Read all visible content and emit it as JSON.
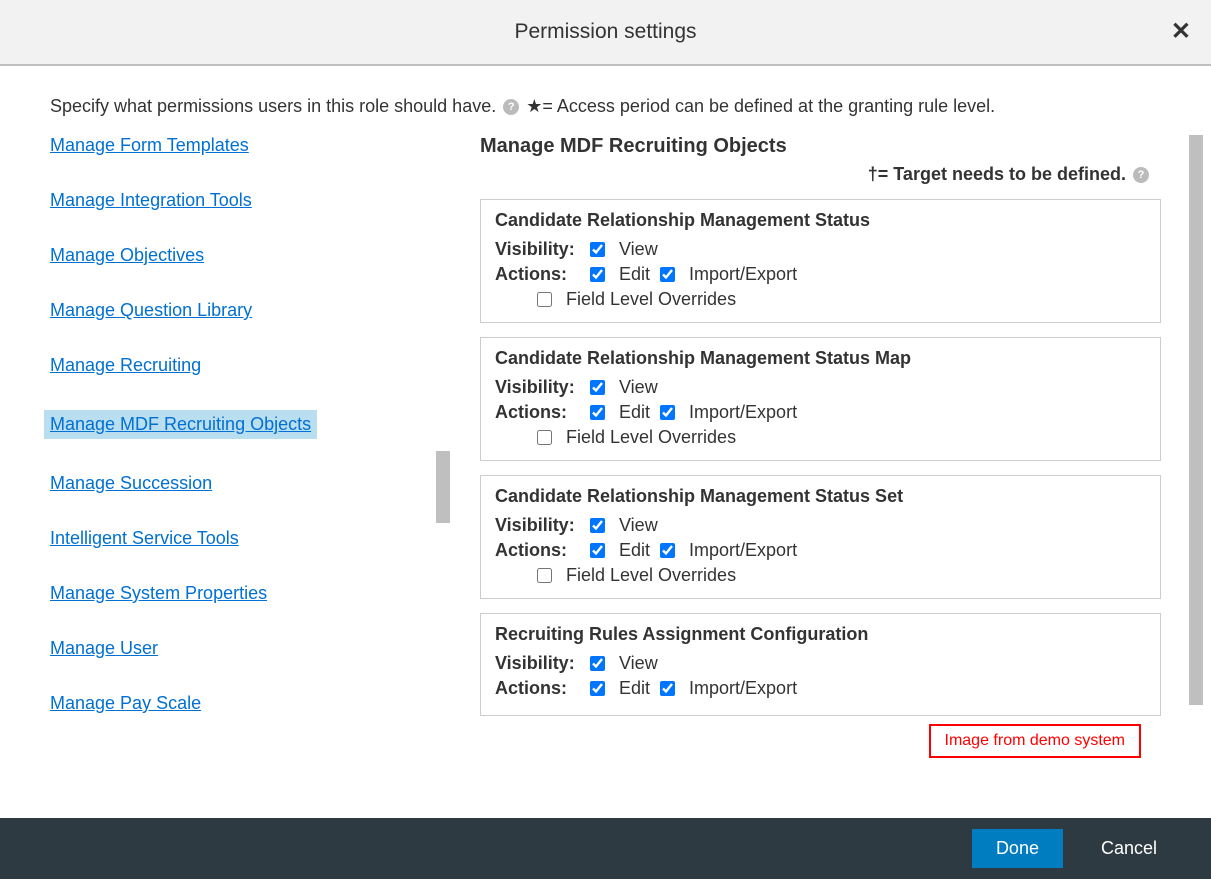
{
  "header": {
    "title": "Permission settings"
  },
  "intro": {
    "text_before_icon": "Specify what permissions users in this role should have.",
    "text_after_icon": "★= Access period can be defined at the granting rule level."
  },
  "sidebar": {
    "items": [
      {
        "label": "Manage Form Templates",
        "selected": false
      },
      {
        "label": "Manage Integration Tools",
        "selected": false
      },
      {
        "label": "Manage Objectives",
        "selected": false
      },
      {
        "label": "Manage Question Library",
        "selected": false
      },
      {
        "label": "Manage Recruiting",
        "selected": false
      },
      {
        "label": "Manage MDF Recruiting Objects",
        "selected": true
      },
      {
        "label": "Manage Succession",
        "selected": false
      },
      {
        "label": "Intelligent Service Tools",
        "selected": false
      },
      {
        "label": "Manage System Properties",
        "selected": false
      },
      {
        "label": "Manage User",
        "selected": false
      },
      {
        "label": "Manage Pay Scale",
        "selected": false
      }
    ]
  },
  "main": {
    "heading": "Manage MDF Recruiting Objects",
    "sub_heading": "†= Target needs to be defined.",
    "labels": {
      "visibility": "Visibility:",
      "actions": "Actions:",
      "view": "View",
      "edit": "Edit",
      "import_export": "Import/Export",
      "flo": "Field Level Overrides"
    },
    "groups": [
      {
        "title": "Candidate Relationship Management Status",
        "view": true,
        "edit": true,
        "import_export": true,
        "flo": false
      },
      {
        "title": "Candidate Relationship Management Status Map",
        "view": true,
        "edit": true,
        "import_export": true,
        "flo": false
      },
      {
        "title": "Candidate Relationship Management Status Set",
        "view": true,
        "edit": true,
        "import_export": true,
        "flo": false
      },
      {
        "title": "Recruiting Rules Assignment Configuration",
        "view": true,
        "edit": true,
        "import_export": true,
        "flo": false
      }
    ]
  },
  "demo_badge": "Image from demo system",
  "footer": {
    "done": "Done",
    "cancel": "Cancel"
  }
}
